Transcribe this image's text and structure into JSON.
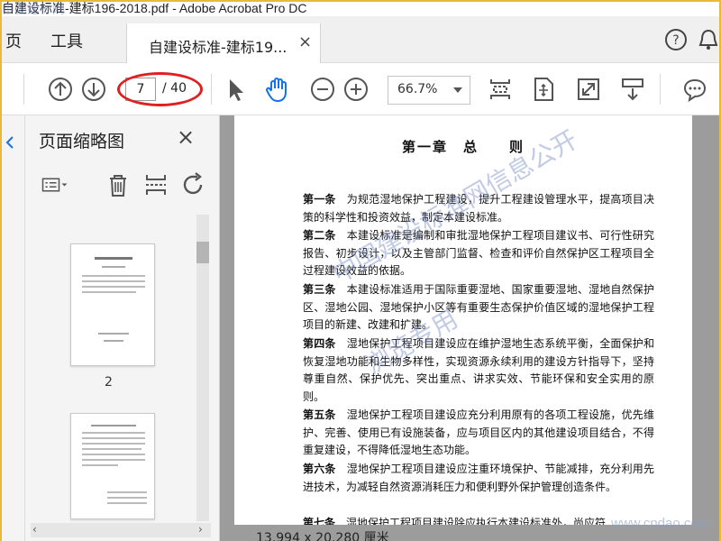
{
  "window": {
    "title": "自建设标准-建标196-2018.pdf - Adobe Acrobat Pro DC"
  },
  "menu": {
    "home": "页",
    "tools": "工具"
  },
  "tab": {
    "label": "自建设标准-建标19...",
    "close": "×"
  },
  "toolbar": {
    "current_page": "7",
    "total_pages": "/ 40",
    "zoom": "66.7%"
  },
  "thumbnails_panel": {
    "title": "页面缩略图",
    "close": "×",
    "page_label": "2"
  },
  "document": {
    "chapter_title": "第一章　总　　则",
    "articles": [
      {
        "label": "第一条",
        "text": "为规范湿地保护工程建设，提升工程建设管理水平，提高项目决策的科学性和投资效益，制定本建设标准。"
      },
      {
        "label": "第二条",
        "text": "本建设标准是编制和审批湿地保护工程项目建议书、可行性研究报告、初步设计，以及主管部门监督、检查和评价自然保护区工程项目全过程建设效益的依据。"
      },
      {
        "label": "第三条",
        "text": "本建设标准适用于国际重要湿地、国家重要湿地、湿地自然保护区、湿地公园、湿地保护小区等有重要生态保护价值区域的湿地保护工程项目的新建、改建和扩建。"
      },
      {
        "label": "第四条",
        "text": "湿地保护工程项目建设应在维护湿地生态系统平衡，全面保护和恢复湿地功能和生物多样性，实现资源永续利用的建设方针指导下，坚持尊重自然、保护优先、突出重点、讲求实效、节能环保和安全实用的原则。"
      },
      {
        "label": "第五条",
        "text": "湿地保护工程项目建设应充分利用原有的各项工程设施，优先维护、完善、使用已有设施装备，应与项目区内的其他建设项目结合，不得重复建设，不得降低湿地生态功能。"
      },
      {
        "label": "第六条",
        "text": "湿地保护工程项目建设应注重环境保护、节能减排，充分利用先进技术，为减轻自然资源消耗压力和便利野外保护管理创造条件。"
      },
      {
        "label": "第七条",
        "text": "湿地保护工程项目建设除应执行本建设标准外，尚应符"
      }
    ],
    "page_size": "13.994 x 20.280 厘米"
  },
  "watermarks": {
    "diag1": "中国建设标准网信息公开",
    "diag2": "浏览专用",
    "corner": "www.cndao.com",
    "top": "中国建标网"
  },
  "colors": {
    "accent_red": "#e02020",
    "toolbar_icon": "#555555",
    "hand_tool": "#1473e6"
  }
}
